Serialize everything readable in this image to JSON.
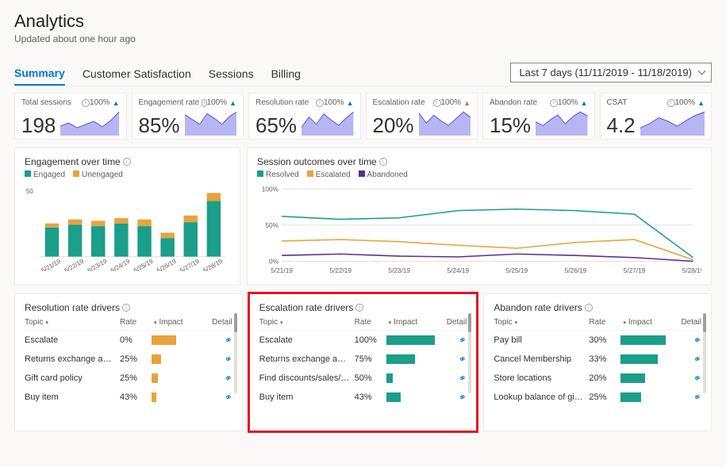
{
  "header": {
    "title": "Analytics",
    "subtitle": "Updated about one hour ago"
  },
  "tabs": [
    "Summary",
    "Customer Satisfaction",
    "Sessions",
    "Billing"
  ],
  "active_tab": 0,
  "date_range": "Last 7 days (11/11/2019 - 11/18/2019)",
  "colors": {
    "teal": "#1b9e8a",
    "orange": "#e8a33d",
    "purple": "#5c2e91",
    "area": "#a5a4f0",
    "barTeal": "#2aa0a0",
    "barOrange": "#e8a33d"
  },
  "kpis": [
    {
      "name": "Total sessions",
      "pct": "100%",
      "trend": "up-b",
      "value": "198"
    },
    {
      "name": "Engagement rate",
      "pct": "100%",
      "trend": "up-b",
      "value": "85%"
    },
    {
      "name": "Resolution rate",
      "pct": "100%",
      "trend": "up-b",
      "value": "65%"
    },
    {
      "name": "Escalation rate",
      "pct": "100%",
      "trend": "up-o",
      "value": "20%"
    },
    {
      "name": "Abandon rate",
      "pct": "100%",
      "trend": "up-b",
      "value": "15%"
    },
    {
      "name": "CSAT",
      "pct": "100%",
      "trend": "up-b",
      "value": "4.2"
    }
  ],
  "engagement_card": {
    "title": "Engagement over time",
    "legend": [
      "Engaged",
      "Unengaged"
    ],
    "y_max_label": "50",
    "categories": [
      "5/21/19",
      "5/22/19",
      "5/23/19",
      "5/24/19",
      "5/25/19",
      "5/26/19",
      "5/27/19",
      "5/28/19"
    ]
  },
  "outcomes_card": {
    "title": "Session outcomes over time",
    "legend": [
      "Resolved",
      "Escalated",
      "Abandoned"
    ],
    "y_labels": [
      "100%",
      "50%",
      "0%"
    ],
    "categories": [
      "5/21/19",
      "5/22/19",
      "5/23/19",
      "5/24/19",
      "5/25/19",
      "5/26/19",
      "5/27/19",
      "5/28/19"
    ]
  },
  "driver_headers": {
    "topic": "Topic",
    "rate": "Rate",
    "impact": "Impact",
    "detail": "Detail"
  },
  "resolution_drivers": {
    "title": "Resolution rate drivers",
    "rows": [
      {
        "topic": "Escalate",
        "rate": "0%"
      },
      {
        "topic": "Returns exchange and re...",
        "rate": "25%"
      },
      {
        "topic": "Gift card policy",
        "rate": "25%"
      },
      {
        "topic": "Buy item",
        "rate": "43%"
      }
    ]
  },
  "escalation_drivers": {
    "title": "Escalation rate drivers",
    "rows": [
      {
        "topic": "Escalate",
        "rate": "100%"
      },
      {
        "topic": "Returns exchange and r...",
        "rate": "75%"
      },
      {
        "topic": "Find discounts/sales/de...",
        "rate": "50%"
      },
      {
        "topic": "Buy item",
        "rate": "43%"
      }
    ]
  },
  "abandon_drivers": {
    "title": "Abandon rate drivers",
    "rows": [
      {
        "topic": "Pay bill",
        "rate": "30%"
      },
      {
        "topic": "Cancel Membership",
        "rate": "33%"
      },
      {
        "topic": "Store locations",
        "rate": "20%"
      },
      {
        "topic": "Lookup balance of gift...",
        "rate": "25%"
      }
    ]
  },
  "chart_data": [
    {
      "type": "area",
      "title": "KPI sparklines",
      "series": [
        {
          "name": "Total sessions",
          "values": [
            12,
            16,
            10,
            14,
            18,
            11,
            19,
            30
          ]
        },
        {
          "name": "Engagement rate",
          "values": [
            22,
            17,
            12,
            23,
            18,
            12,
            20,
            25
          ]
        },
        {
          "name": "Resolution rate",
          "values": [
            8,
            18,
            11,
            21,
            15,
            10,
            17,
            23
          ]
        },
        {
          "name": "Escalation rate",
          "values": [
            20,
            11,
            18,
            13,
            9,
            15,
            21,
            16
          ]
        },
        {
          "name": "Abandon rate",
          "values": [
            14,
            10,
            16,
            21,
            12,
            19,
            24,
            20
          ]
        },
        {
          "name": "CSAT",
          "values": [
            9,
            14,
            21,
            17,
            11,
            18,
            24,
            28
          ]
        }
      ]
    },
    {
      "type": "bar",
      "title": "Engagement over time",
      "categories": [
        "5/21/19",
        "5/22/19",
        "5/23/19",
        "5/24/19",
        "5/25/19",
        "5/26/19",
        "5/27/19",
        "5/28/19"
      ],
      "series": [
        {
          "name": "Engaged",
          "values": [
            22,
            24,
            23,
            25,
            23,
            14,
            26,
            42
          ]
        },
        {
          "name": "Unengaged",
          "values": [
            3,
            4,
            4,
            4,
            5,
            4,
            5,
            6
          ]
        }
      ],
      "ylim": [
        0,
        50
      ]
    },
    {
      "type": "line",
      "title": "Session outcomes over time",
      "categories": [
        "5/21/19",
        "5/22/19",
        "5/23/19",
        "5/24/19",
        "5/25/19",
        "5/26/19",
        "5/27/19",
        "5/28/19"
      ],
      "series": [
        {
          "name": "Resolved",
          "values": [
            62,
            58,
            60,
            70,
            72,
            70,
            65,
            5
          ]
        },
        {
          "name": "Escalated",
          "values": [
            28,
            30,
            27,
            22,
            18,
            26,
            30,
            2
          ]
        },
        {
          "name": "Abandoned",
          "values": [
            8,
            10,
            7,
            6,
            10,
            8,
            5,
            0
          ]
        }
      ],
      "ylabel": "%",
      "ylim": [
        0,
        100
      ]
    },
    {
      "type": "bar",
      "title": "Resolution rate drivers — Impact",
      "categories": [
        "Escalate",
        "Returns exchange and re...",
        "Gift card policy",
        "Buy item"
      ],
      "series": [
        {
          "name": "Impact",
          "values": [
            30,
            12,
            8,
            6
          ]
        }
      ]
    },
    {
      "type": "bar",
      "title": "Escalation rate drivers — Impact",
      "categories": [
        "Escalate",
        "Returns exchange and r...",
        "Find discounts/sales/de...",
        "Buy item"
      ],
      "series": [
        {
          "name": "Impact",
          "values": [
            60,
            35,
            8,
            18
          ]
        }
      ]
    },
    {
      "type": "bar",
      "title": "Abandon rate drivers — Impact",
      "categories": [
        "Pay bill",
        "Cancel Membership",
        "Store locations",
        "Lookup balance of gift..."
      ],
      "series": [
        {
          "name": "Impact",
          "values": [
            55,
            45,
            30,
            25
          ]
        }
      ]
    }
  ]
}
